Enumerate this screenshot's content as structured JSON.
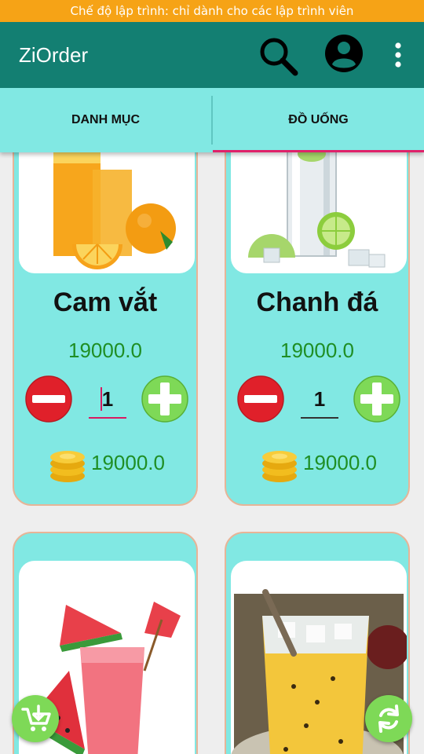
{
  "status": {
    "dev_mode_text": "Chế độ lập trình: chỉ dành cho các lập trình viên"
  },
  "appbar": {
    "title": "ZiOrder",
    "icons": [
      "search-icon",
      "account-circle-icon",
      "more-vertical-icon"
    ]
  },
  "tabs": [
    {
      "label": "DANH MỤC",
      "selected": false
    },
    {
      "label": "ĐỒ UỐNG",
      "selected": true
    }
  ],
  "products": [
    {
      "name": "Cam vắt",
      "price": "19000.0",
      "quantity": "1",
      "total": "19000.0",
      "image": "orange-juice-image"
    },
    {
      "name": "Chanh đá",
      "price": "19000.0",
      "quantity": "1",
      "total": "19000.0",
      "image": "lemon-ice-image"
    },
    {
      "name": "",
      "price": "",
      "quantity": "",
      "total": "",
      "image": "watermelon-juice-image"
    },
    {
      "name": "",
      "price": "",
      "quantity": "",
      "total": "",
      "image": "passion-fruit-juice-image"
    }
  ],
  "fabs": {
    "cart_icon": "cart-download-icon",
    "refresh_icon": "refresh-icon"
  },
  "colors": {
    "status_bar": "#f6a316",
    "app_bar": "#137f72",
    "tab_bar": "#81e8e3",
    "tab_indicator": "#e0226a",
    "card": "#81e8e3",
    "card_border": "#e7b497",
    "price_text": "#1f8e24",
    "minus_button": "#e0202a",
    "plus_button": "#7ed957"
  }
}
